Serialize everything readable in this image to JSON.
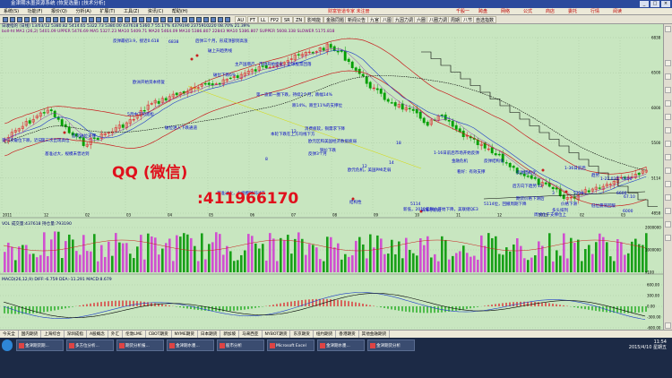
{
  "window": {
    "title": "金津期水墨资源系统 (恢复选量) [技术分析]",
    "controls": [
      "_",
      "□",
      "×"
    ]
  },
  "menu": {
    "items": [
      "系统(S)",
      "功能(F)",
      "报价(Q)",
      "分析(A)",
      "扩展(T)",
      "工具(Z)",
      "资讯(C)",
      "帮助(H)"
    ],
    "ad_text": "财富管道专家 未注册",
    "right_buttons": [
      "千股一",
      "跨盘",
      "网络",
      "公式",
      "商店",
      "委托",
      "行情",
      "阅读"
    ]
  },
  "toolbar": {
    "buttons": [
      "AU",
      "FT",
      "LL",
      "FP2",
      "SR",
      "ZN",
      "影响能",
      "金融同题",
      "新闻公告",
      "九官",
      "八图",
      "九因力调",
      "六圈",
      "八圈力调",
      "周期",
      "八节",
      "自选指数"
    ]
  },
  "info": {
    "line1": "日收指的 (日线) 13/03/12 5380.82 5414.65 5322.73 5380.00 437618 5360.7 55.17% 4379190 2375910220 08.70% 21.39%",
    "line2": "boll-ht MA1 (26,2) 5401.09 UPPER 5476.69 MA5 5327.23 MA10 5409.71 MA20 5464.09 MA10 5386.807 22843 MA10 5386.807 SUPPER 5608.338 SLOWER 5175.818"
  },
  "chart_data": {
    "type": "candlestick",
    "price_axis": [
      "6838",
      "6500",
      "6000",
      "5500",
      "5114",
      "4858"
    ],
    "price_axis_right": [
      "6838",
      "6286",
      "5808",
      "5600",
      "5114"
    ],
    "x_axis": [
      "2011",
      "12",
      "02",
      "03",
      "04",
      "05",
      "06",
      "07",
      "08",
      "09",
      "10",
      "11",
      "12",
      "2013",
      "02",
      "03"
    ],
    "annotations": [
      "反弹最初3.9，接近0.618",
      "6838",
      "后弹三个月，形成顶部到高涨",
      "破上升趋势线",
      "主产国增产，市场开始担忧，全球股票回落",
      "破位下跌6%",
      "第一波第一圈下跌，持续2个月，跌幅14%",
      "跌14%，跌至11%的支撑位",
      "本轮下跌在上方均线下方",
      "消费疲软，铜需求下降",
      "12",
      "8",
      "欧元区和美国经济数据疲弱",
      "铜价下跌",
      "反弹3个月",
      "18",
      "结构性",
      "14",
      "12",
      "5114",
      "新低，2012年铜价开始下降，美联储QE3",
      "1-16日前后市场开始反弹",
      "金融危机",
      "反弹结构化",
      "看好：有效支撑",
      "反弹结构化",
      "后方向下趋势",
      "12",
      "3",
      "5229",
      "多头排列",
      "1-36日前后",
      "趋势",
      "1-22.03年",
      "6800",
      "6600",
      "67.10",
      "6000",
      "第一次破位下跌，近日",
      "第三次出现高位",
      "基准过大，规模未曾达到",
      "首次破位支撑",
      "5月中下旬宽松",
      "欧洲开始资本修复",
      "破位进入下跌通道",
      "基准过大，大规模时间过了",
      "欧元危机，美国PMI走弱",
      "去库存阶段",
      "5114位，回撤周期下降",
      "周线位于支撑位上",
      "期货价格下滑后",
      "价格下滑",
      "低位震荡回暖"
    ],
    "vol_label": "VOL 成交量:437618 持仓量:793190",
    "vol_axis": [
      "2000000",
      "1000000",
      "x100"
    ],
    "macd_label": "MACD(26,12,9) DIFF:-6.759 DEA:-11.291 MACD:8.679",
    "macd_axis": [
      "600.00",
      "300.00",
      "0.00",
      "-300.00",
      "-600.00"
    ],
    "colors": {
      "background": "#c8e6c0",
      "up_candle": "#e0101c",
      "down_candle": "#00a000",
      "ma_red": "#c81e1e",
      "ma_blue": "#1e3cc8",
      "ma_purple": "#8a2fa8",
      "boll_black": "#000000",
      "vol_magenta": "#d050d0",
      "vol_green": "#18a018"
    }
  },
  "watermark": {
    "line1": "QQ (微信)",
    "line2": ":411966170"
  },
  "bottom_tabs": [
    "今天全",
    "国内期货",
    "上海综合",
    "深圳成指",
    "A股概念",
    "外汇",
    "伦敦LME",
    "CBOT期货",
    "NYME期货",
    "日本期货",
    "新加坡",
    "马来西亚",
    "NYBOT期货",
    "东京期货",
    "纽约期货",
    "香港期货",
    "其他金融期货"
  ],
  "taskbar": {
    "tasks": [
      "金津期货期...",
      "多方位分析...",
      "期货分析报...",
      "金津期水墨...",
      "股市分析",
      "Microsoft Excel",
      "金津期水墨...",
      "金津期货分析"
    ],
    "time": "11:54",
    "date": "2015/4/10 星期五"
  }
}
